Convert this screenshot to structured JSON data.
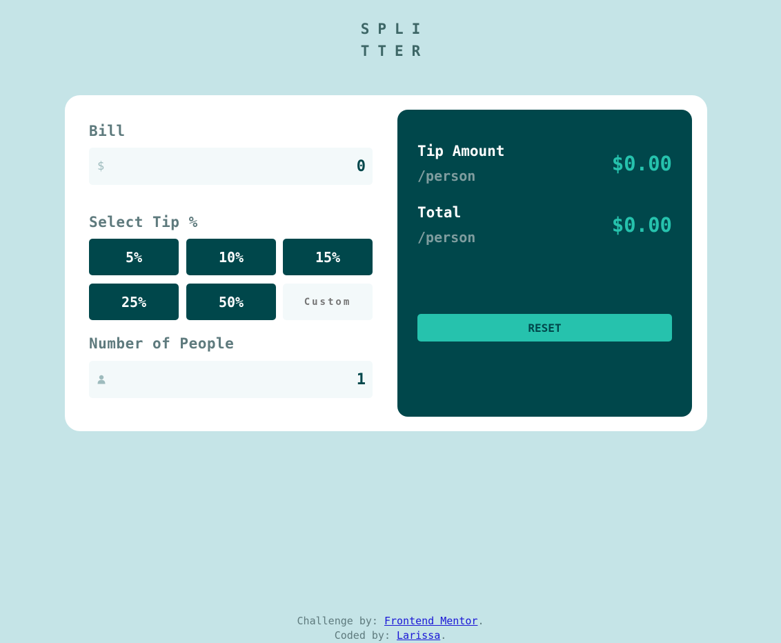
{
  "logo": {
    "line1": "SPLI",
    "line2": "TTER"
  },
  "form": {
    "bill": {
      "label": "Bill",
      "icon": "dollar-icon",
      "icon_glyph": "$",
      "value": "0"
    },
    "tip": {
      "label": "Select Tip %",
      "options": [
        "5%",
        "10%",
        "15%",
        "25%",
        "50%"
      ],
      "custom_placeholder": "Custom"
    },
    "people": {
      "label": "Number of People",
      "icon": "person-icon",
      "value": "1"
    }
  },
  "results": {
    "tip_amount": {
      "title": "Tip Amount",
      "sub": "/person",
      "value": "$0.00"
    },
    "total": {
      "title": "Total",
      "sub": "/person",
      "value": "$0.00"
    },
    "reset_label": "RESET"
  },
  "footer": {
    "challenge_prefix": "Challenge by: ",
    "challenge_link": "Frontend Mentor",
    "challenge_suffix": ".",
    "coded_prefix": "Coded by: ",
    "coded_link": "Larissa",
    "coded_suffix": "."
  },
  "colors": {
    "background": "#c5e4e7",
    "dark_cyan": "#00474b",
    "accent": "#26c2ad",
    "label": "#5e7a7d"
  }
}
